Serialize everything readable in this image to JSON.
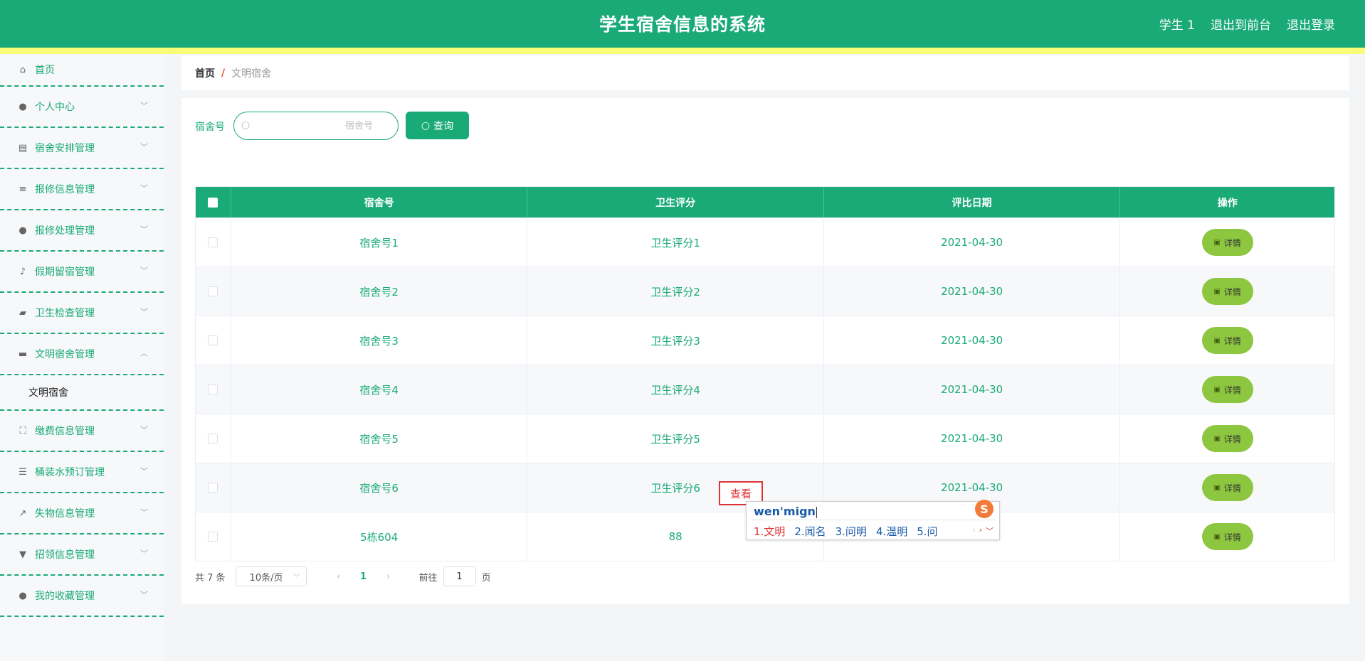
{
  "header": {
    "title": "学生宿舍信息的系统",
    "links": [
      "学生 1",
      "退出到前台",
      "退出登录"
    ]
  },
  "sidebar": {
    "items": [
      {
        "label": "首页",
        "icon": "home-icon"
      },
      {
        "label": "个人中心",
        "icon": "user-icon"
      },
      {
        "label": "宿舍安排管理",
        "icon": "clipboard-icon"
      },
      {
        "label": "报修信息管理",
        "icon": "sliders-icon"
      },
      {
        "label": "报修处理管理",
        "icon": "user-icon"
      },
      {
        "label": "假期留宿管理",
        "icon": "microphone-icon"
      },
      {
        "label": "卫生检查管理",
        "icon": "briefcase-icon"
      },
      {
        "label": "文明宿舍管理",
        "icon": "monitor-icon"
      },
      {
        "label": "缴费信息管理",
        "icon": "fullscreen-icon"
      },
      {
        "label": "桶装水预订管理",
        "icon": "list-icon"
      },
      {
        "label": "失物信息管理",
        "icon": "chart-icon"
      },
      {
        "label": "招领信息管理",
        "icon": "brush-icon"
      },
      {
        "label": "我的收藏管理",
        "icon": "user-icon"
      }
    ],
    "sub_item": "文明宿舍"
  },
  "breadcrumb": {
    "home": "首页",
    "separator": "/",
    "current": "文明宿舍"
  },
  "search": {
    "label": "宿舍号",
    "placeholder": "宿舍号",
    "button": "查询"
  },
  "table": {
    "headers": [
      "宿舍号",
      "卫生评分",
      "评比日期",
      "操作"
    ],
    "rows": [
      {
        "room": "宿舍号1",
        "score": "卫生评分1",
        "date": "2021-04-30",
        "action": "详情"
      },
      {
        "room": "宿舍号2",
        "score": "卫生评分2",
        "date": "2021-04-30",
        "action": "详情"
      },
      {
        "room": "宿舍号3",
        "score": "卫生评分3",
        "date": "2021-04-30",
        "action": "详情"
      },
      {
        "room": "宿舍号4",
        "score": "卫生评分4",
        "date": "2021-04-30",
        "action": "详情"
      },
      {
        "room": "宿舍号5",
        "score": "卫生评分5",
        "date": "2021-04-30",
        "action": "详情"
      },
      {
        "room": "宿舍号6",
        "score": "卫生评分6",
        "date": "2021-04-30",
        "action": "详情"
      },
      {
        "room": "5栋604",
        "score": "88",
        "date": "",
        "action": "详情"
      }
    ]
  },
  "pagination": {
    "total": "共 7 条",
    "page_size": "10条/页",
    "current_page": "1",
    "goto_prefix": "前往",
    "goto_value": "1",
    "goto_suffix": "页"
  },
  "ime": {
    "tooltip": "查看",
    "composition": "wen'mign",
    "candidates": [
      "1.文明",
      "2.闻名",
      "3.问明",
      "4.温明",
      "5.问"
    ],
    "logo": "S"
  },
  "colors": {
    "primary": "#1aaa78",
    "stripe": "#fbfb7a",
    "detail_button": "#8dc63f",
    "breadcrumb_separator": "#e0522c"
  }
}
